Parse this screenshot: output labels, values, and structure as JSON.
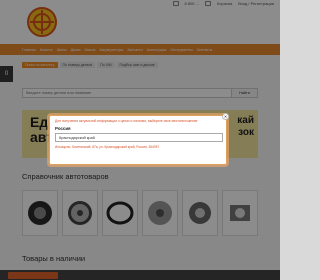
{
  "header": {
    "topbar": {
      "phone": "8 800 ...",
      "cart": "Корзина",
      "login": "Вход / Регистрация"
    }
  },
  "nav": {
    "items": [
      "Главная",
      "Каталог",
      "Шины",
      "Диски",
      "Масла",
      "Аккумуляторы",
      "Запчасти",
      "Аксессуары",
      "Инструменты",
      "Контакты"
    ]
  },
  "left_badge": "0",
  "search": {
    "tabs": [
      "Поиск по каталогу",
      "По номеру детали",
      "По VIN",
      "Подбор шин и дисков"
    ],
    "placeholder": "Введите номер детали или название",
    "button_label": "Найти"
  },
  "banner": {
    "left_text": "Еди\nавто",
    "right_text": "кай\nзок"
  },
  "sections": {
    "catalog_title": "Справочник автотоваров",
    "in_stock_title": "Товары в наличии"
  },
  "modal": {
    "hint": "Для получения актуальной информации о ценах и наличии, выберите свое местоположение",
    "country": "Россия",
    "selected_region": "Краснодарский край",
    "address": "Ильицыно, Кочетинский, 87а, ул. Краснодарский край, Россия, 354057"
  },
  "colors": {
    "accent": "#e8892e",
    "hint_red": "#d6502a"
  }
}
